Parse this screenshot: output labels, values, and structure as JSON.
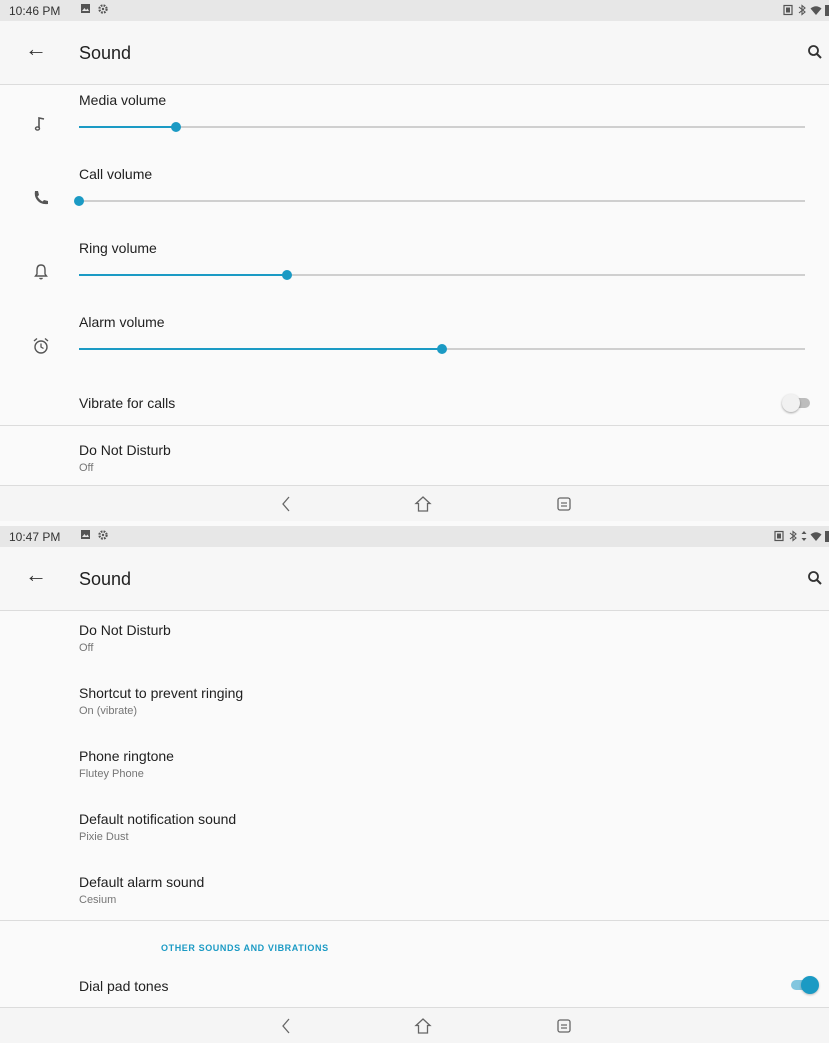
{
  "screens": [
    {
      "status_bar": {
        "time": "10:46 PM"
      },
      "app_bar": {
        "title": "Sound"
      },
      "volumes": [
        {
          "label": "Media volume",
          "icon": "music-note-icon",
          "level": 0.134
        },
        {
          "label": "Call volume",
          "icon": "phone-icon",
          "level": 0.0
        },
        {
          "label": "Ring volume",
          "icon": "bell-icon",
          "level": 0.286
        },
        {
          "label": "Alarm volume",
          "icon": "alarm-clock-icon",
          "level": 0.5
        }
      ],
      "vibrate": {
        "label": "Vibrate for calls",
        "on": false
      },
      "dnd": {
        "title": "Do Not Disturb",
        "value": "Off"
      }
    },
    {
      "status_bar": {
        "time": "10:47 PM"
      },
      "app_bar": {
        "title": "Sound"
      },
      "items": [
        {
          "title": "Do Not Disturb",
          "value": "Off"
        },
        {
          "title": "Shortcut to prevent ringing",
          "value": "On (vibrate)"
        },
        {
          "title": "Phone ringtone",
          "value": "Flutey Phone"
        },
        {
          "title": "Default notification sound",
          "value": "Pixie Dust"
        },
        {
          "title": "Default alarm sound",
          "value": "Cesium"
        }
      ],
      "section_header": "OTHER SOUNDS AND VIBRATIONS",
      "dial_pad": {
        "label": "Dial pad tones",
        "on": true
      }
    }
  ],
  "colors": {
    "accent": "#1b9ac4",
    "track": "#cfcfcf",
    "status_bar": "#e7e7e7"
  }
}
